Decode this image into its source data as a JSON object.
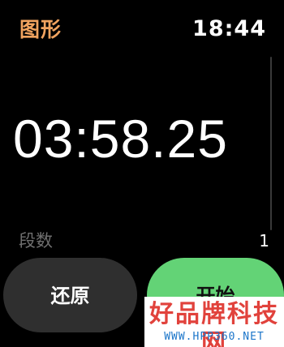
{
  "header": {
    "app_title": "图形",
    "time": "18:44"
  },
  "stopwatch": {
    "elapsed": "03:58.25",
    "laps_label": "段数",
    "laps_count": "1"
  },
  "actions": {
    "reset_label": "还原",
    "start_label": "开始"
  },
  "watermark": {
    "title": "好品牌科技网",
    "url": "WWW.HPP360.NET"
  },
  "colors": {
    "accent": "#f0a35f",
    "start": "#63d376",
    "reset": "#2f2f2f",
    "background": "#000000"
  }
}
